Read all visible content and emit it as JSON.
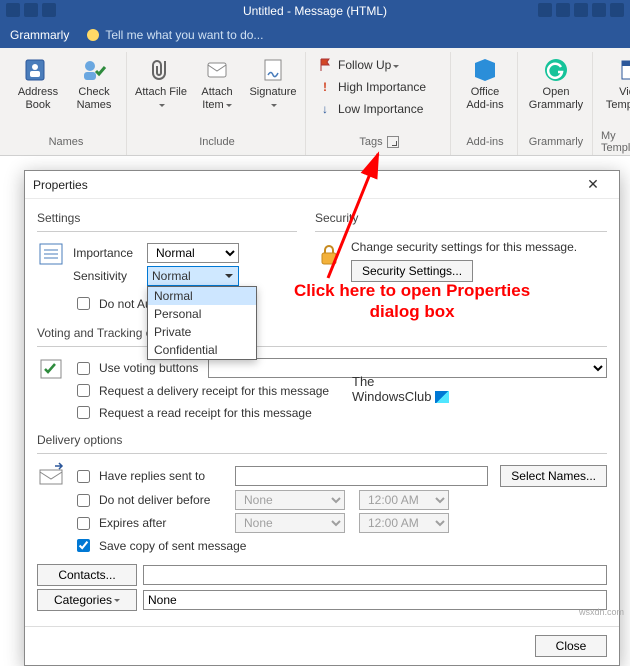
{
  "window": {
    "title": "Untitled - Message (HTML)"
  },
  "tabstrip": {
    "active": "Grammarly",
    "tell": "Tell me what you want to do..."
  },
  "ribbon": {
    "groups": {
      "names": {
        "label": "Names",
        "addressBook": "Address Book",
        "checkNames": "Check Names"
      },
      "include": {
        "label": "Include",
        "attachFile": "Attach File",
        "attachItem": "Attach Item",
        "signature": "Signature"
      },
      "tags": {
        "label": "Tags",
        "followUp": "Follow Up",
        "highImportance": "High Importance",
        "lowImportance": "Low Importance"
      },
      "addins": {
        "label": "Add-ins",
        "officeAddins": "Office Add-ins"
      },
      "grammarly": {
        "label": "Grammarly",
        "open": "Open Grammarly"
      },
      "mytemplates": {
        "label": "My Templates",
        "view": "View Templates"
      }
    }
  },
  "annotation": {
    "line1": "Click here to open Properties",
    "line2": "dialog box"
  },
  "dialog": {
    "title": "Properties",
    "settings": {
      "heading": "Settings",
      "importanceLabel": "Importance",
      "importanceValue": "Normal",
      "sensitivityLabel": "Sensitivity",
      "sensitivityValue": "Normal",
      "sensitivityOptions": [
        "Normal",
        "Personal",
        "Private",
        "Confidential"
      ],
      "doNotAutoArchive": "Do not AutoArchive this item"
    },
    "security": {
      "heading": "Security",
      "text": "Change security settings for this message.",
      "button": "Security Settings..."
    },
    "voting": {
      "heading": "Voting and Tracking options",
      "useVoting": "Use voting buttons",
      "deliveryReceipt": "Request a delivery receipt for this message",
      "readReceipt": "Request a read receipt for this message"
    },
    "delivery": {
      "heading": "Delivery options",
      "haveReplies": "Have replies sent to",
      "selectNames": "Select Names...",
      "doNotDeliverBefore": "Do not deliver before",
      "expiresAfter": "Expires after",
      "dateNone": "None",
      "time": "12:00 AM",
      "saveCopy": "Save copy of sent message",
      "contacts": "Contacts...",
      "categories": "Categories",
      "categoriesValue": "None"
    },
    "close": "Close"
  },
  "watermark": {
    "line1": "The",
    "line2": "WindowsClub"
  },
  "credit": "wsxdn.com"
}
